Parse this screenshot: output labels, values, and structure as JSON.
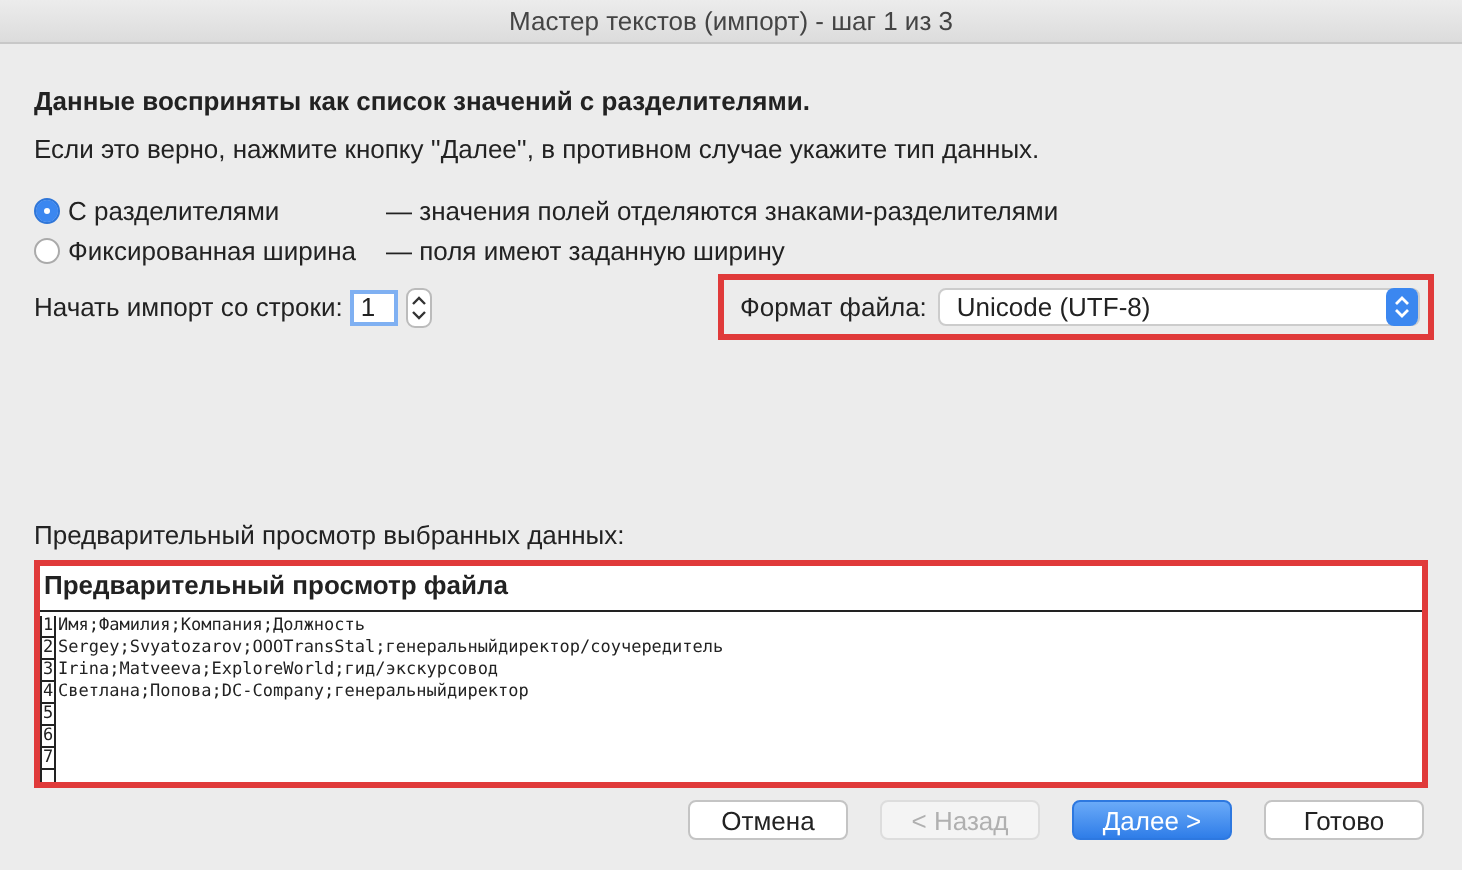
{
  "window": {
    "title": "Мастер текстов (импорт) - шаг 1 из 3"
  },
  "heading": "Данные восприняты как список значений с разделителями.",
  "instruction": "Если это верно, нажмите кнопку ''Далее'', в противном случае укажите тип данных.",
  "data_types": [
    {
      "label": "С разделителями",
      "description": "— значения полей отделяются знаками-разделителями",
      "selected": true
    },
    {
      "label": "Фиксированная ширина",
      "description": "— поля имеют заданную ширину",
      "selected": false
    }
  ],
  "start_row": {
    "label": "Начать импорт со строки:",
    "value": "1"
  },
  "file_format": {
    "label": "Формат файла:",
    "value": "Unicode (UTF-8)"
  },
  "preview": {
    "label": "Предварительный просмотр выбранных данных:",
    "title": "Предварительный просмотр файла",
    "rows": [
      {
        "number": "1",
        "text": "Имя;Фамилия;Компания;Должность"
      },
      {
        "number": "2",
        "text": "Sergey;Svyatozarov;OOOTransStal;генеральныйдиректор/соучередитель"
      },
      {
        "number": "3",
        "text": "Irina;Matveeva;ExploreWorld;гид/экскурсовод"
      },
      {
        "number": "4",
        "text": "Светлана;Попова;DC-Company;генеральныйдиректор"
      },
      {
        "number": "5"
      },
      {
        "number": "6"
      },
      {
        "number": "7"
      }
    ]
  },
  "buttons": [
    {
      "label": "Отмена",
      "kind": "normal"
    },
    {
      "label": "< Назад",
      "kind": "disabled"
    },
    {
      "label": "Далее >",
      "kind": "primary"
    },
    {
      "label": "Готово",
      "kind": "normal"
    }
  ]
}
